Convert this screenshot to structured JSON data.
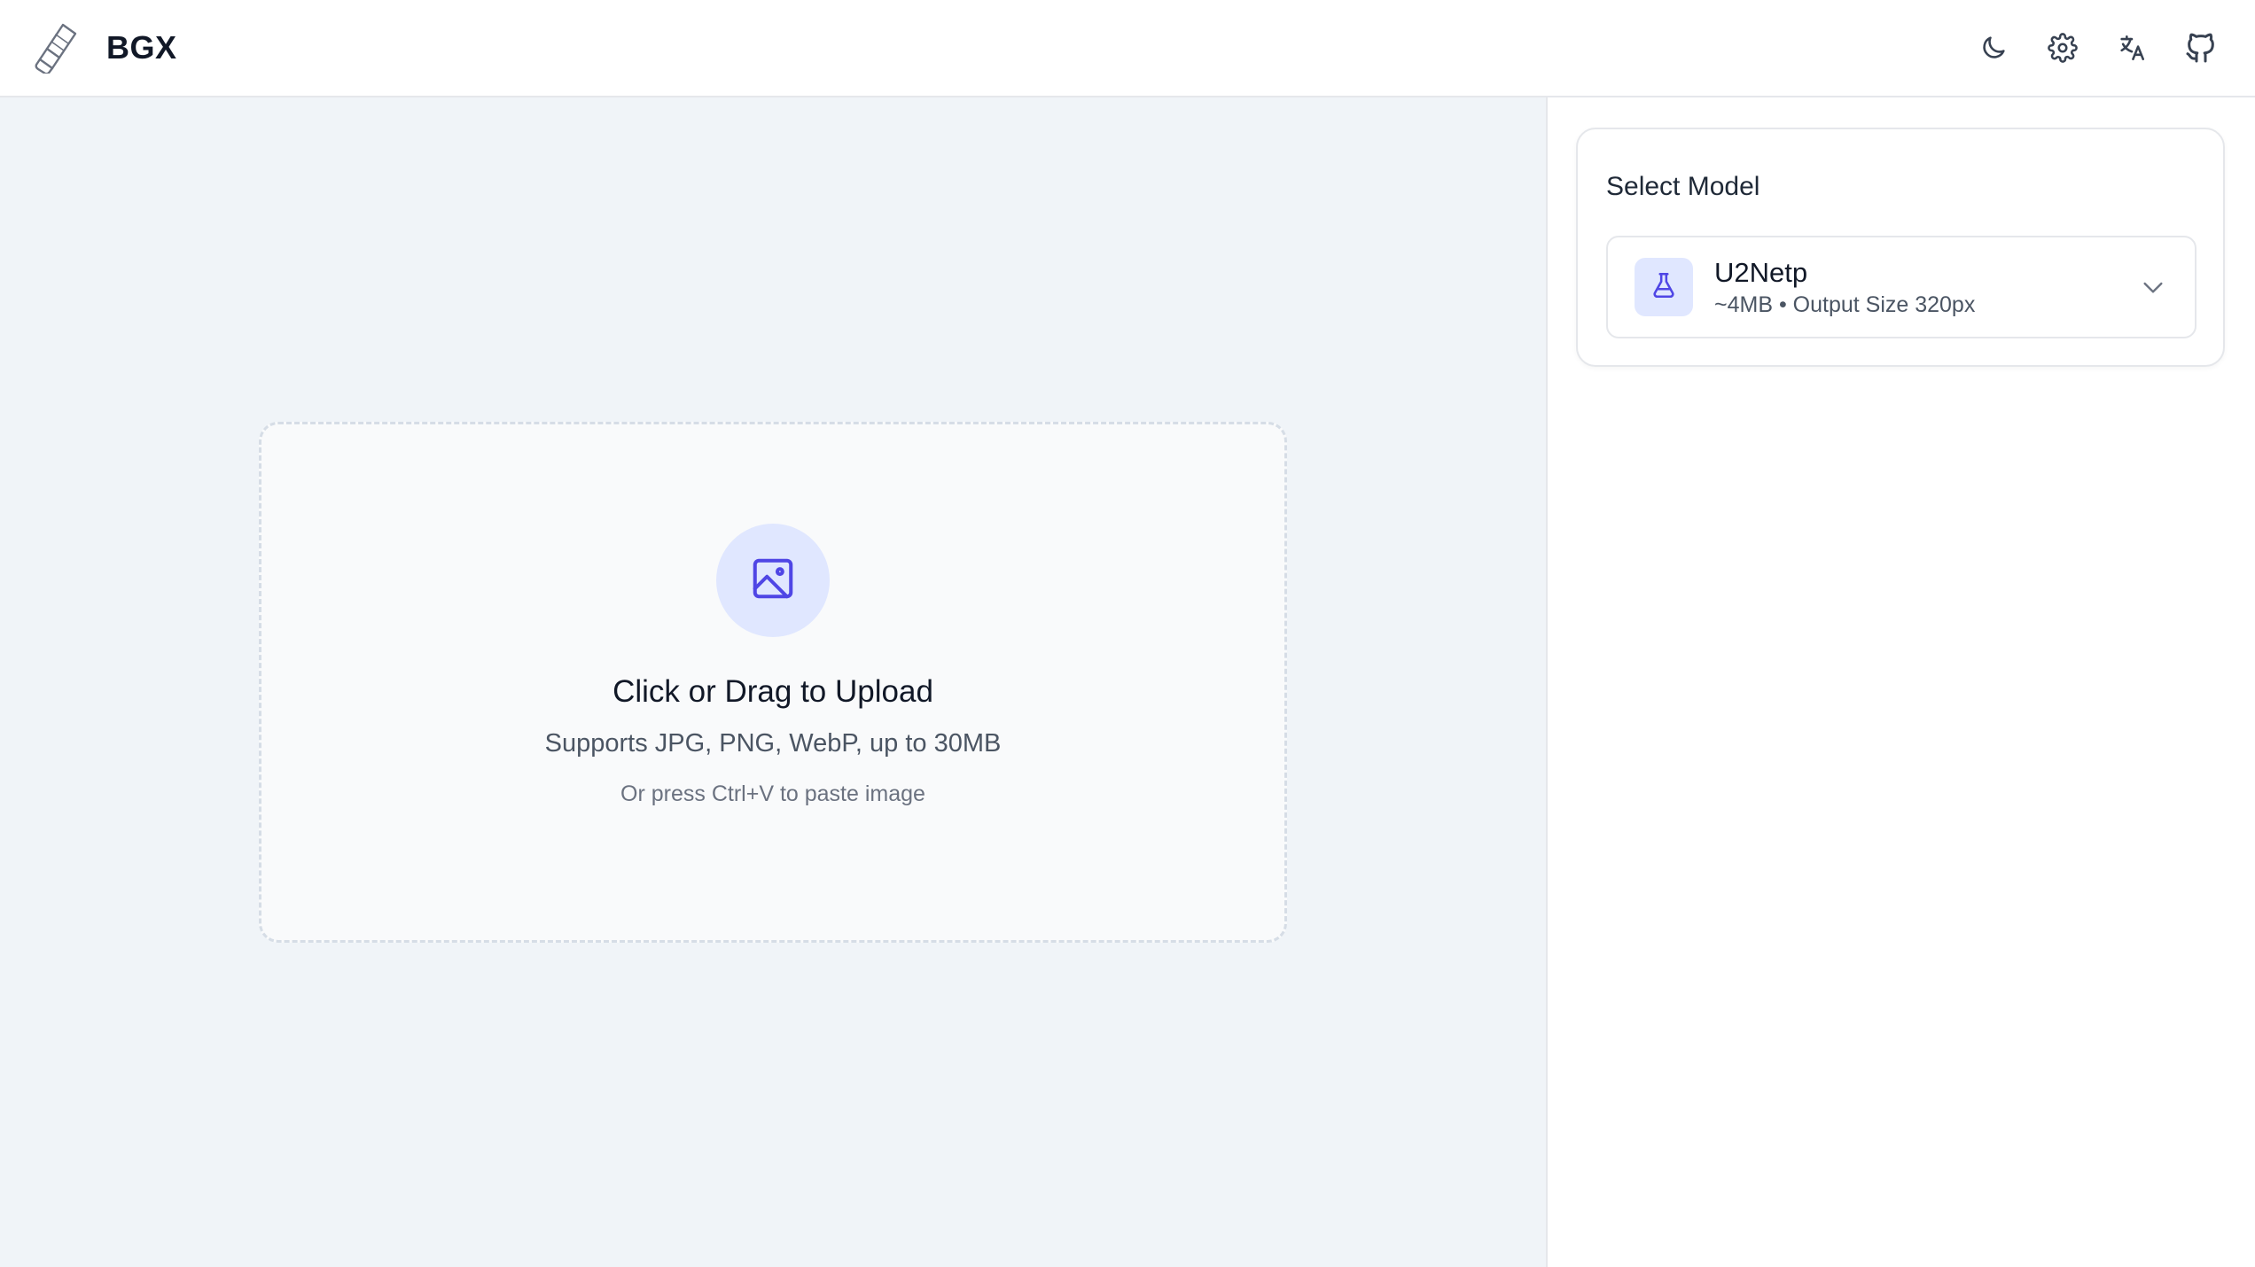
{
  "header": {
    "title": "BGX",
    "logo_icon": "eraser-icon",
    "actions": [
      {
        "name": "theme-toggle-button",
        "icon": "moon-icon"
      },
      {
        "name": "settings-button",
        "icon": "gear-icon"
      },
      {
        "name": "language-button",
        "icon": "translate-icon"
      },
      {
        "name": "github-button",
        "icon": "github-icon"
      }
    ]
  },
  "upload": {
    "icon": "image-icon",
    "title": "Click or Drag to Upload",
    "subtitle": "Supports JPG, PNG, WebP, up to 30MB",
    "hint": "Or press Ctrl+V to paste image"
  },
  "sidebar": {
    "model_section_title": "Select Model",
    "selected_model": {
      "icon": "flask-icon",
      "name": "U2Netp",
      "description": "~4MB • Output Size 320px"
    }
  },
  "colors": {
    "accent": "#4f46e5",
    "accent_soft": "#e0e7ff",
    "main_bg": "#f0f4f8",
    "border": "#e5e7eb"
  }
}
